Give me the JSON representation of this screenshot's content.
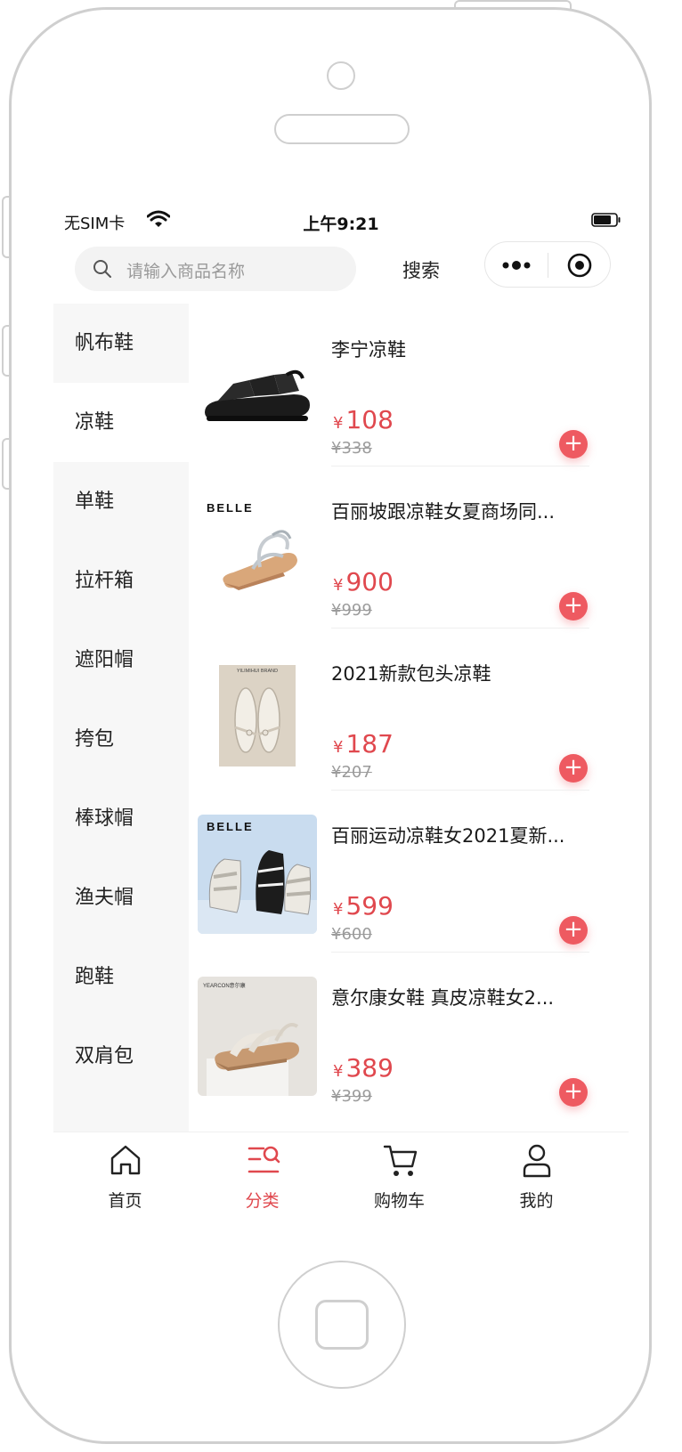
{
  "status_bar": {
    "carrier": "无SIM卡",
    "time": "上午9:21"
  },
  "search": {
    "placeholder": "请输入商品名称",
    "button_label": "搜索"
  },
  "categories": [
    "帆布鞋",
    "凉鞋",
    "单鞋",
    "拉杆箱",
    "遮阳帽",
    "挎包",
    "棒球帽",
    "渔夫帽",
    "跑鞋",
    "双肩包"
  ],
  "active_category": "凉鞋",
  "products": [
    {
      "name": "李宁凉鞋",
      "currency": "¥",
      "price": "108",
      "original_price": "¥338"
    },
    {
      "name": "百丽坡跟凉鞋女夏商场同...",
      "currency": "¥",
      "price": "900",
      "original_price": "¥999",
      "image_text": "BELLE"
    },
    {
      "name": "2021新款包头凉鞋",
      "currency": "¥",
      "price": "187",
      "original_price": "¥207",
      "image_text": "YILIMIHUI BRAND"
    },
    {
      "name": "百丽运动凉鞋女2021夏新...",
      "currency": "¥",
      "price": "599",
      "original_price": "¥600",
      "image_text": "BELLE"
    },
    {
      "name": "意尔康女鞋 真皮凉鞋女2...",
      "currency": "¥",
      "price": "389",
      "original_price": "¥399",
      "image_text": "YEARCON意尔康"
    }
  ],
  "tabbar": [
    {
      "label": "首页",
      "icon": "home-icon"
    },
    {
      "label": "分类",
      "icon": "category-search-icon"
    },
    {
      "label": "购物车",
      "icon": "cart-icon"
    },
    {
      "label": "我的",
      "icon": "user-icon"
    }
  ],
  "active_tab": "分类",
  "colors": {
    "accent": "#e0484e",
    "add_button": "#ee5a61",
    "sidebar_bg": "#f7f7f7"
  }
}
